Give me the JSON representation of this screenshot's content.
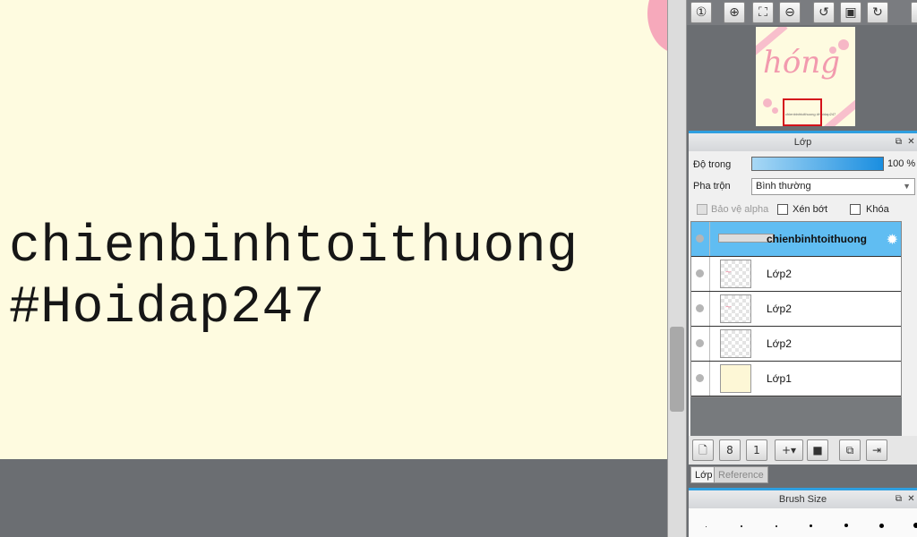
{
  "canvas": {
    "text_line1": "chienbinhtoithuong",
    "text_line2": "#Hoidap247"
  },
  "navigator": {
    "buttons": [
      {
        "name": "zoom-100-icon",
        "glyph": "①"
      },
      {
        "name": "zoom-in-icon",
        "glyph": "⊕"
      },
      {
        "name": "fit-window-icon",
        "glyph": "⛶"
      },
      {
        "name": "zoom-out-icon",
        "glyph": "⊖"
      },
      {
        "name": "rotate-left-icon",
        "glyph": "↺"
      },
      {
        "name": "reset-view-icon",
        "glyph": "▣"
      },
      {
        "name": "rotate-right-icon",
        "glyph": "↻"
      }
    ],
    "thumb_word": "hóng",
    "thumb_small_text": "chienbinhtoithuong #Hoidap247"
  },
  "layer_panel": {
    "title": "Lớp",
    "opacity_label": "Độ trong",
    "opacity_value": "100 %",
    "opacity_level": 1.0,
    "blend_label": "Pha trộn",
    "blend_value": "Bình thường",
    "protect_alpha_label": "Bảo vệ alpha",
    "clipping_label": "Xén bớt",
    "lock_label": "Khóa",
    "layers": [
      {
        "name": "chienbinhtoithuong",
        "selected": true,
        "thumb": "textline"
      },
      {
        "name": "Lớp2",
        "selected": false,
        "thumb": "pink"
      },
      {
        "name": "Lớp2",
        "selected": false,
        "thumb": "pink"
      },
      {
        "name": "Lớp2",
        "selected": false,
        "thumb": "checker"
      },
      {
        "name": "Lớp1",
        "selected": false,
        "thumb": "cream"
      }
    ],
    "toolbar": [
      {
        "name": "new-layer-icon",
        "glyph": "🗋"
      },
      {
        "name": "new-halftone-layer-icon",
        "glyph": "8"
      },
      {
        "name": "new-1bit-layer-icon",
        "glyph": "1"
      },
      {
        "name": "add-layer-menu-icon",
        "glyph": "+▾"
      },
      {
        "name": "new-folder-icon",
        "glyph": "■"
      },
      {
        "name": "duplicate-layer-icon",
        "glyph": "⧉"
      },
      {
        "name": "merge-layer-icon",
        "glyph": "⇥"
      }
    ],
    "tabs": {
      "active": "Lớp",
      "other": "Reference"
    }
  },
  "brush_panel": {
    "title": "Brush Size"
  },
  "colors": {
    "canvas_bg": "#fefbe0",
    "selected_layer": "#60bdf2",
    "accent_bar": "#2e9fe0",
    "pink": "#f29aae"
  }
}
